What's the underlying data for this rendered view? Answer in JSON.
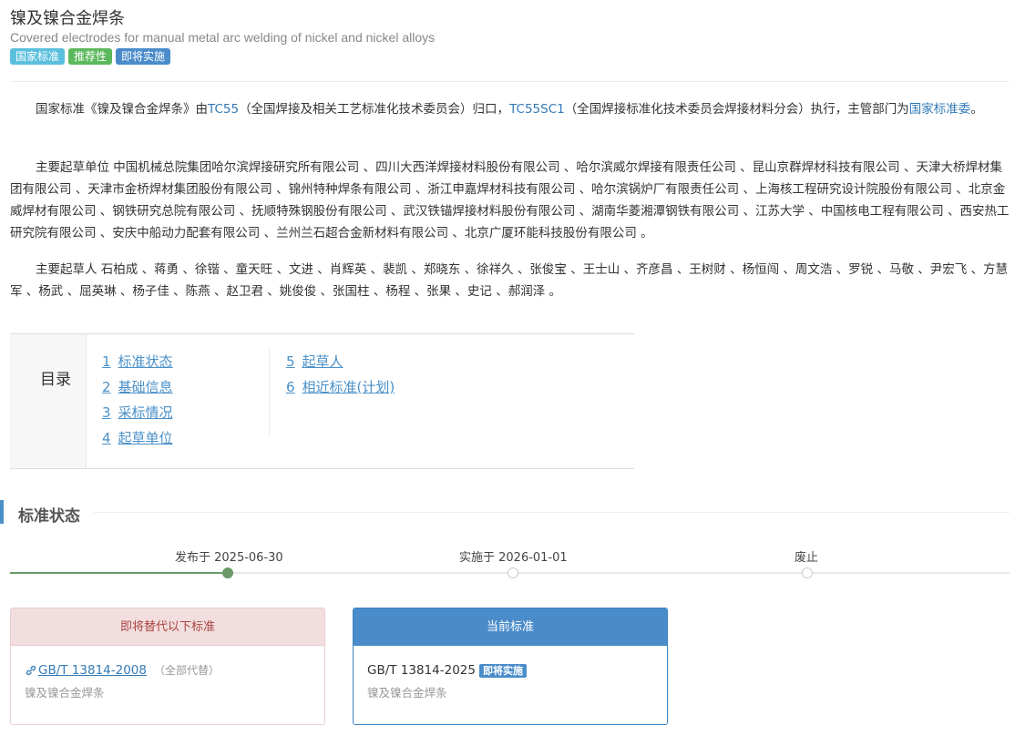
{
  "header": {
    "title": "镍及镍合金焊条",
    "subtitle": "Covered electrodes for manual metal arc welding of nickel and nickel alloys",
    "badges": [
      {
        "label": "国家标准",
        "color": "#5bc0de"
      },
      {
        "label": "推荐性",
        "color": "#5cb85c"
      },
      {
        "label": "即将实施",
        "color": "#4a8cca"
      }
    ]
  },
  "intro": {
    "p1_a": "国家标准《镍及镍合金焊条》由",
    "p1_link1": "TC55",
    "p1_b": "（全国焊接及相关工艺标准化技术委员会）归口，",
    "p1_link2": "TC55SC1",
    "p1_c": "（全国焊接标准化技术委员会焊接材料分会）执行，主管部门为",
    "p1_link3": "国家标准委",
    "p1_d": "。",
    "p2": "主要起草单位 中国机械总院集团哈尔滨焊接研究所有限公司 、四川大西洋焊接材料股份有限公司 、哈尔滨威尔焊接有限责任公司 、昆山京群焊材科技有限公司 、天津大桥焊材集团有限公司 、天津市金桥焊材集团股份有限公司 、锦州特种焊条有限公司 、浙江申嘉焊材科技有限公司 、哈尔滨锅炉厂有限责任公司 、上海核工程研究设计院股份有限公司 、北京金威焊材有限公司 、钢铁研究总院有限公司 、抚顺特殊钢股份有限公司 、武汉铁锚焊接材料股份有限公司 、湖南华菱湘潭钢铁有限公司 、江苏大学 、中国核电工程有限公司 、西安热工研究院有限公司 、安庆中船动力配套有限公司 、兰州兰石超合金新材料有限公司 、北京广厦环能科技股份有限公司 。",
    "p3": "主要起草人 石柏成 、蒋勇 、徐锴 、童天旺 、文进 、肖辉英 、裴凯 、郑晓东 、徐祥久 、张俊宝 、王士山 、齐彦昌 、王树财 、杨恒闯 、周文浩 、罗锐 、马敬 、尹宏飞 、方慧军 、杨武 、屈英琳 、杨子佳 、陈燕 、赵卫君 、姚俊俊 、张国柱 、杨程 、张果 、史记 、郝润泽 。"
  },
  "toc": {
    "label": "目录",
    "items": [
      {
        "num": "1",
        "label": "标准状态"
      },
      {
        "num": "2",
        "label": "基础信息"
      },
      {
        "num": "3",
        "label": "采标情况"
      },
      {
        "num": "4",
        "label": "起草单位"
      },
      {
        "num": "5",
        "label": "起草人"
      },
      {
        "num": "6",
        "label": "相近标准(计划)"
      }
    ]
  },
  "status": {
    "section_title": "标准状态",
    "timeline": [
      {
        "label": "发布于 2025-06-30",
        "done": true
      },
      {
        "label": "实施于 2026-01-01",
        "done": false
      },
      {
        "label": "废止",
        "done": false
      }
    ],
    "replaces": {
      "header": "即将替代以下标准",
      "code": "GB/T 13814-2008",
      "note": "（全部代替）",
      "name": "镍及镍合金焊条"
    },
    "current": {
      "header": "当前标准",
      "code": "GB/T 13814-2025",
      "tag": "即将实施",
      "name": "镍及镍合金焊条"
    }
  }
}
